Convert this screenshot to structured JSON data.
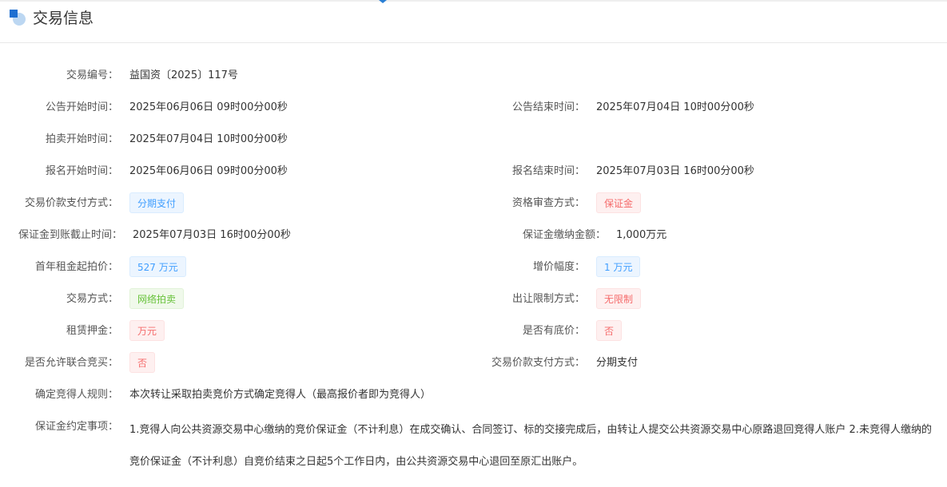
{
  "header": {
    "title": "交易信息"
  },
  "fields": {
    "trade_no": {
      "label": "交易编号：",
      "value": "益国资〔2025〕117号"
    },
    "notice_start": {
      "label": "公告开始时间：",
      "value": "2025年06月06日 09时00分00秒"
    },
    "notice_end": {
      "label": "公告结束时间：",
      "value": "2025年07月04日 10时00分00秒"
    },
    "auction_start": {
      "label": "拍卖开始时间：",
      "value": "2025年07月04日 10时00分00秒"
    },
    "signup_start": {
      "label": "报名开始时间：",
      "value": "2025年06月06日 09时00分00秒"
    },
    "signup_end": {
      "label": "报名结束时间：",
      "value": "2025年07月03日 16时00分00秒"
    },
    "payment_method": {
      "label": "交易价款支付方式：",
      "value": "分期支付"
    },
    "qualification_method": {
      "label": "资格审查方式：",
      "value": "保证金"
    },
    "deposit_deadline": {
      "label": "保证金到账截止时间：",
      "value": "2025年07月03日 16时00分00秒"
    },
    "deposit_amount": {
      "label": "保证金缴纳金额：",
      "value": "1,000万元"
    },
    "first_year_rent": {
      "label": "首年租金起拍价：",
      "value": "527 万元"
    },
    "increment": {
      "label": "增价幅度：",
      "value": "1 万元"
    },
    "trade_mode": {
      "label": "交易方式：",
      "value": "网络拍卖"
    },
    "transfer_limit": {
      "label": "出让限制方式：",
      "value": "无限制"
    },
    "lease_deposit": {
      "label": "租赁押金：",
      "value": "万元"
    },
    "reserve_price": {
      "label": "是否有底价：",
      "value": "否"
    },
    "joint_bid": {
      "label": "是否允许联合竞买：",
      "value": "否"
    },
    "payment_method_2": {
      "label": "交易价款支付方式：",
      "value": "分期支付"
    },
    "winner_rule": {
      "label": "确定竞得人规则：",
      "value": "本次转让采取拍卖竞价方式确定竞得人（最高报价者即为竞得人）"
    },
    "deposit_terms": {
      "label": "保证金约定事项：",
      "value": "1.竞得人向公共资源交易中心缴纳的竞价保证金（不计利息）在成交确认、合同签订、标的交接完成后，由转让人提交公共资源交易中心原路退回竞得人账户 2.未竞得人缴纳的竞价保证金（不计利息）自竞价结束之日起5个工作日内，由公共资源交易中心退回至原汇出账户。"
    }
  },
  "colors": {
    "tag_blue": "#409eff",
    "tag_red": "#f56c6c",
    "tag_green": "#67c23a",
    "header_icon": "#1e6fd1"
  }
}
